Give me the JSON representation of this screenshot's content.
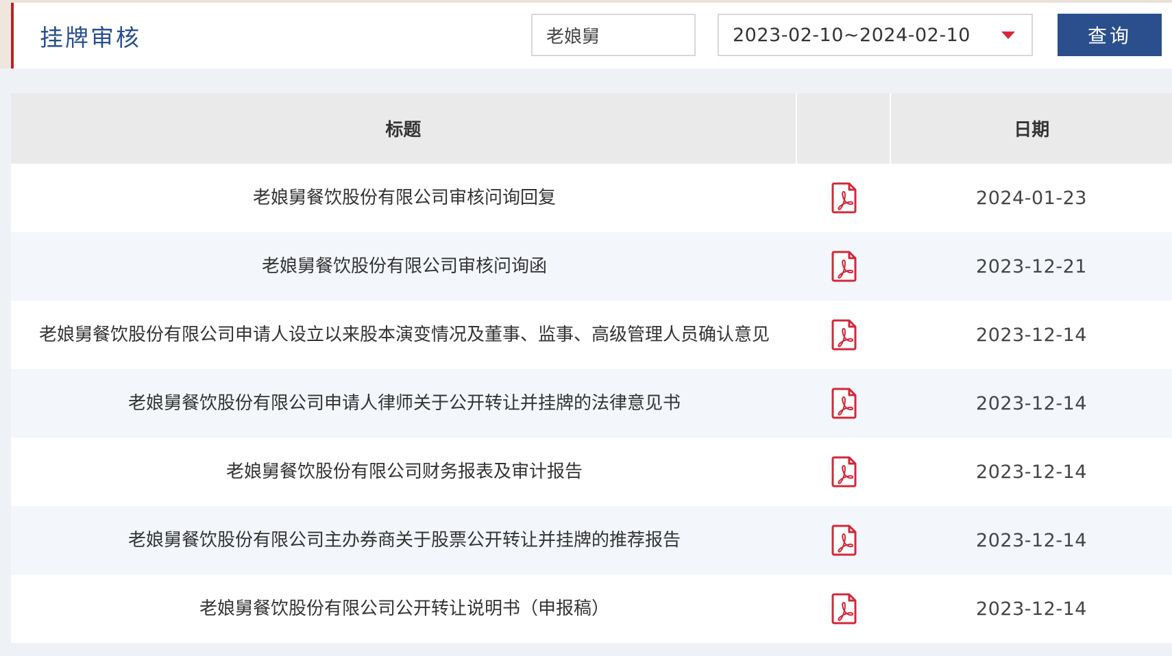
{
  "header": {
    "title": "挂牌审核",
    "keyword_value": "老娘舅",
    "date_range": "2023-02-10~2024-02-10",
    "query_label": "查询",
    "accent_color": "#c21d2a",
    "brand_color": "#2a4f8c"
  },
  "table": {
    "columns": {
      "title": "标题",
      "file": "",
      "date": "日期"
    },
    "rows": [
      {
        "title": "老娘舅餐饮股份有限公司审核问询回复",
        "file_icon": "pdf-icon",
        "date": "2024-01-23"
      },
      {
        "title": "老娘舅餐饮股份有限公司审核问询函",
        "file_icon": "pdf-icon",
        "date": "2023-12-21"
      },
      {
        "title": "老娘舅餐饮股份有限公司申请人设立以来股本演变情况及董事、监事、高级管理人员确认意见",
        "file_icon": "pdf-icon",
        "date": "2023-12-14"
      },
      {
        "title": "老娘舅餐饮股份有限公司申请人律师关于公开转让并挂牌的法律意见书",
        "file_icon": "pdf-icon",
        "date": "2023-12-14"
      },
      {
        "title": "老娘舅餐饮股份有限公司财务报表及审计报告",
        "file_icon": "pdf-icon",
        "date": "2023-12-14"
      },
      {
        "title": "老娘舅餐饮股份有限公司主办券商关于股票公开转让并挂牌的推荐报告",
        "file_icon": "pdf-icon",
        "date": "2023-12-14"
      },
      {
        "title": "老娘舅餐饮股份有限公司公开转让说明书（申报稿）",
        "file_icon": "pdf-icon",
        "date": "2023-12-14"
      }
    ]
  }
}
